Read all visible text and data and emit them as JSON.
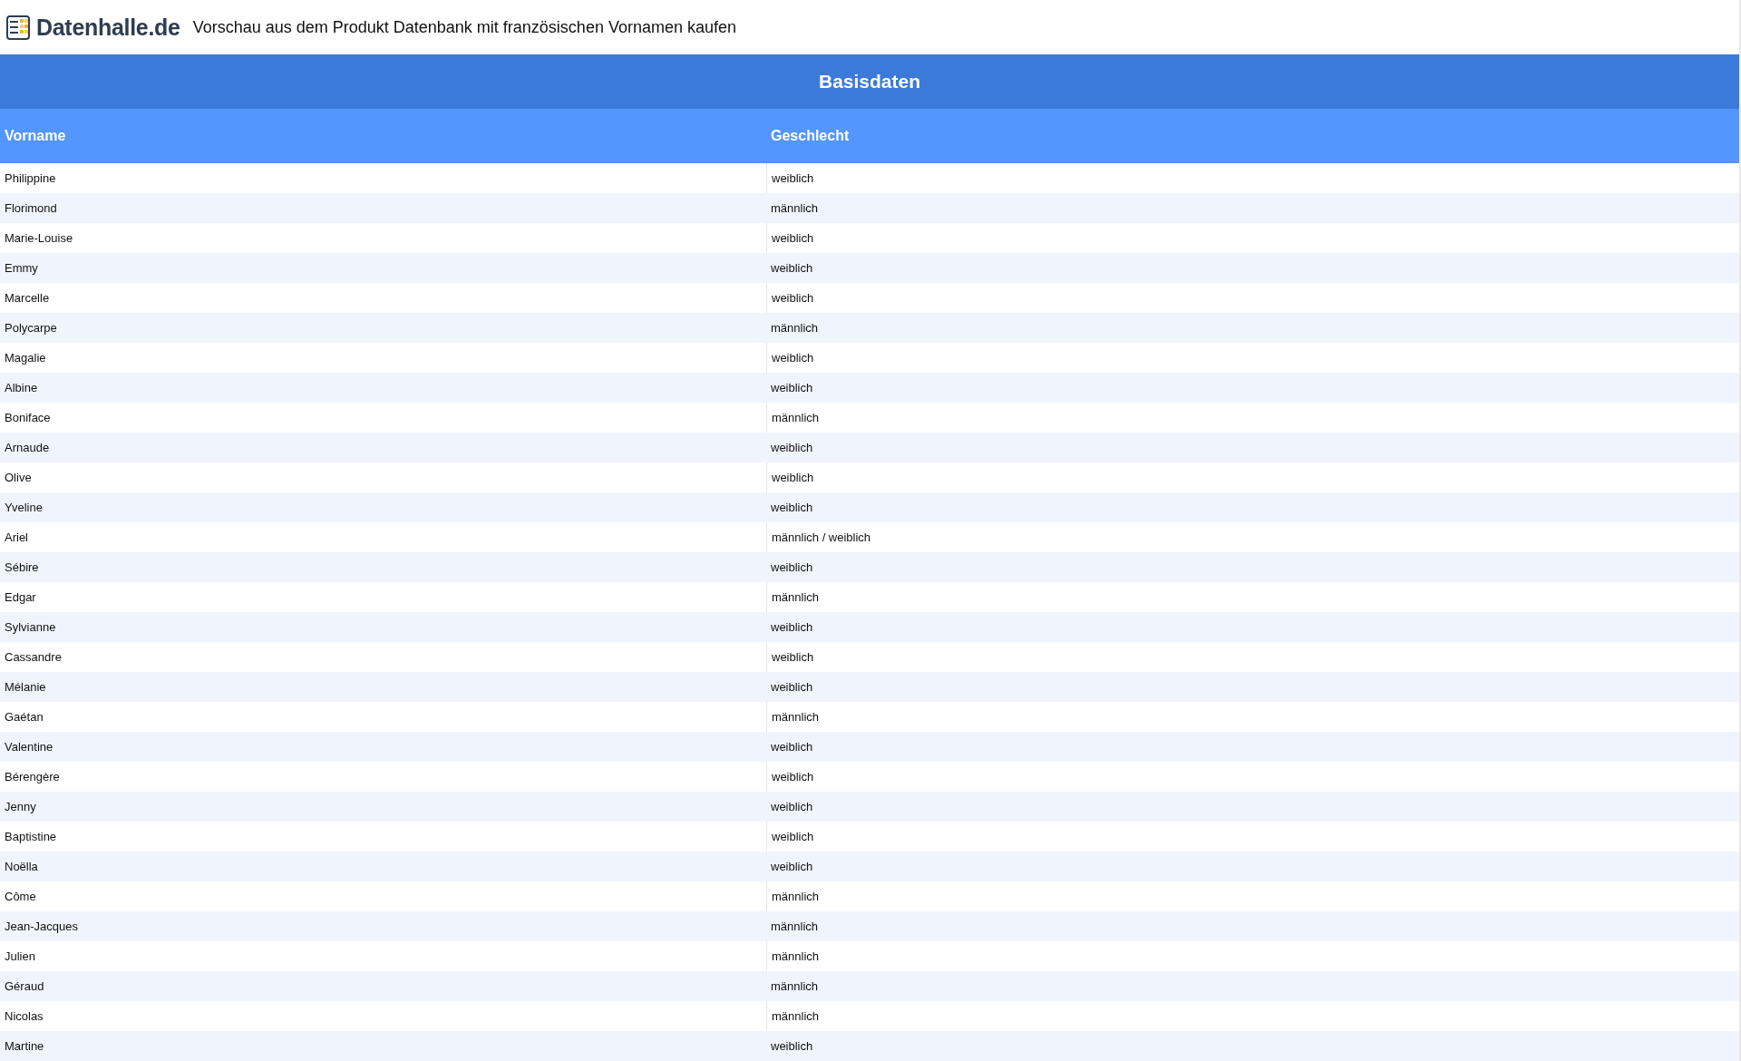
{
  "header": {
    "logo_text": "Datenhalle.de",
    "title": "Vorschau aus dem Produkt Datenbank mit französischen Vornamen kaufen"
  },
  "table": {
    "caption": "Basisdaten",
    "columns": [
      "Vorname",
      "Geschlecht"
    ],
    "rows": [
      [
        "Philippine",
        "weiblich"
      ],
      [
        "Florimond",
        "männlich"
      ],
      [
        "Marie-Louise",
        "weiblich"
      ],
      [
        "Emmy",
        "weiblich"
      ],
      [
        "Marcelle",
        "weiblich"
      ],
      [
        "Polycarpe",
        "männlich"
      ],
      [
        "Magalie",
        "weiblich"
      ],
      [
        "Albine",
        "weiblich"
      ],
      [
        "Boniface",
        "männlich"
      ],
      [
        "Arnaude",
        "weiblich"
      ],
      [
        "Olive",
        "weiblich"
      ],
      [
        "Yveline",
        "weiblich"
      ],
      [
        "Ariel",
        "männlich / weiblich"
      ],
      [
        "Sébire",
        "weiblich"
      ],
      [
        "Edgar",
        "männlich"
      ],
      [
        "Sylvianne",
        "weiblich"
      ],
      [
        "Cassandre",
        "weiblich"
      ],
      [
        "Mélanie",
        "weiblich"
      ],
      [
        "Gaétan",
        "männlich"
      ],
      [
        "Valentine",
        "weiblich"
      ],
      [
        "Bérengère",
        "weiblich"
      ],
      [
        "Jenny",
        "weiblich"
      ],
      [
        "Baptistine",
        "weiblich"
      ],
      [
        "Noëlla",
        "weiblich"
      ],
      [
        "Côme",
        "männlich"
      ],
      [
        "Jean-Jacques",
        "männlich"
      ],
      [
        "Julien",
        "männlich"
      ],
      [
        "Géraud",
        "männlich"
      ],
      [
        "Nicolas",
        "männlich"
      ],
      [
        "Martine",
        "weiblich"
      ]
    ]
  }
}
